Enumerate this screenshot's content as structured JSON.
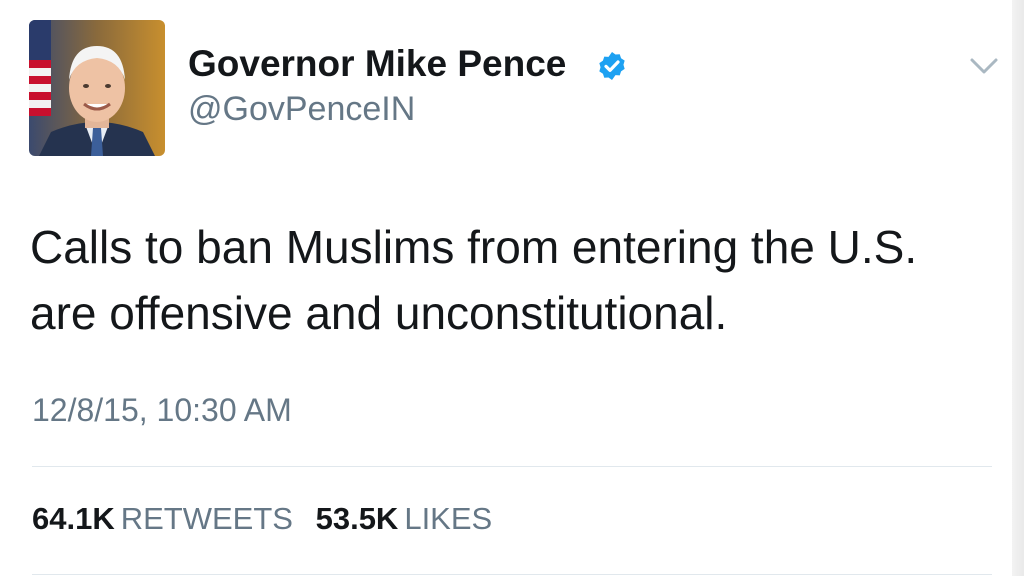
{
  "tweet": {
    "display_name": "Governor Mike Pence",
    "handle": "@GovPenceIN",
    "verified": true,
    "text": "Calls to ban Muslims from entering the U.S. are offensive and unconstitutional.",
    "timestamp": "12/8/15, 10:30 AM",
    "retweets": {
      "count": "64.1K",
      "label": "RETWEETS"
    },
    "likes": {
      "count": "53.5K",
      "label": "LIKES"
    }
  },
  "icons": {
    "verified": "verified-badge-icon",
    "menu": "chevron-down-icon"
  },
  "colors": {
    "primary_text": "#14171a",
    "secondary_text": "#657786",
    "verified_blue": "#1da1f2",
    "divider": "#e1e8ed"
  }
}
